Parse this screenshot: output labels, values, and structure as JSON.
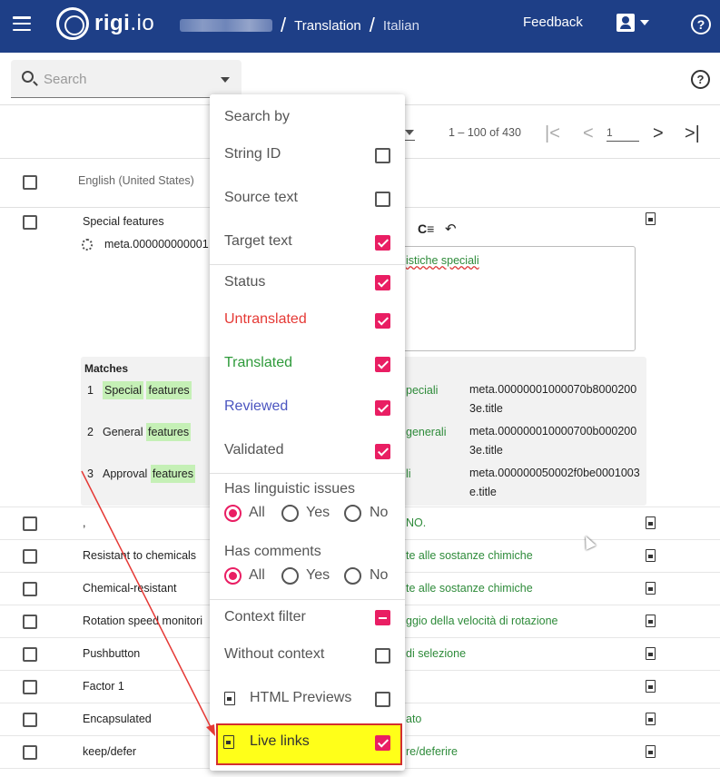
{
  "header": {
    "logo_text": "rigi",
    "logo_suffix": ".io",
    "breadcrumb": [
      "Translation",
      "Italian"
    ],
    "feedback_label": "Feedback"
  },
  "search": {
    "placeholder": "Search"
  },
  "pagination": {
    "range_text": "1 – 100 of 430",
    "page_value": "1"
  },
  "table": {
    "source_language": "English (United States)",
    "expanded_row": {
      "source": "Special features",
      "id": "meta.000000000001",
      "target": "istiche speciali",
      "matches_title": "Matches",
      "matches": [
        {
          "num": "1",
          "src_a": "Special",
          "src_b": "features",
          "tgt": "peciali",
          "meta": "meta.00000001000070b80002003e.title"
        },
        {
          "num": "2",
          "src_a": "General",
          "src_b": "features",
          "tgt": "generali",
          "meta": "meta.000000010000700b0002003e.title"
        },
        {
          "num": "3",
          "src_a": "Approval",
          "src_b": "features",
          "tgt": "li",
          "meta": "meta.000000050002f0be0001003e.title"
        }
      ]
    },
    "rows": [
      {
        "source": ",",
        "target": "NO."
      },
      {
        "source": "Resistant to chemicals",
        "target": "te alle sostanze chimiche"
      },
      {
        "source": "Chemical-resistant",
        "target": "te alle sostanze chimiche"
      },
      {
        "source": "Rotation speed monitori",
        "target": "ggio della velocità di rotazione"
      },
      {
        "source": "Pushbutton",
        "target": "di selezione"
      },
      {
        "source": "Factor 1",
        "target": ""
      },
      {
        "source": "Encapsulated",
        "target": "ato"
      },
      {
        "source": "keep/defer",
        "target": "re/deferire"
      }
    ]
  },
  "search_panel": {
    "search_by_heading": "Search by",
    "search_by": [
      {
        "label": "String ID",
        "checked": false
      },
      {
        "label": "Source text",
        "checked": false
      },
      {
        "label": "Target text",
        "checked": true
      }
    ],
    "status_heading": "Status",
    "status": [
      {
        "label": "Untranslated",
        "color": "#e53935",
        "checked": true
      },
      {
        "label": "Translated",
        "color": "#2e9a3a",
        "checked": true
      },
      {
        "label": "Reviewed",
        "color": "#4b55c0",
        "checked": true
      },
      {
        "label": "Validated",
        "color": "#555555",
        "checked": true
      }
    ],
    "linguistic_heading": "Has linguistic issues",
    "comments_heading": "Has comments",
    "radio_options": [
      "All",
      "Yes",
      "No"
    ],
    "context_heading": "Context filter",
    "without_context_label": "Without context",
    "html_previews_label": "HTML Previews",
    "live_links_label": "Live links"
  },
  "colors": {
    "header_bg": "#1e3f87",
    "accent": "#e91e63",
    "highlight": "#ffff19"
  }
}
